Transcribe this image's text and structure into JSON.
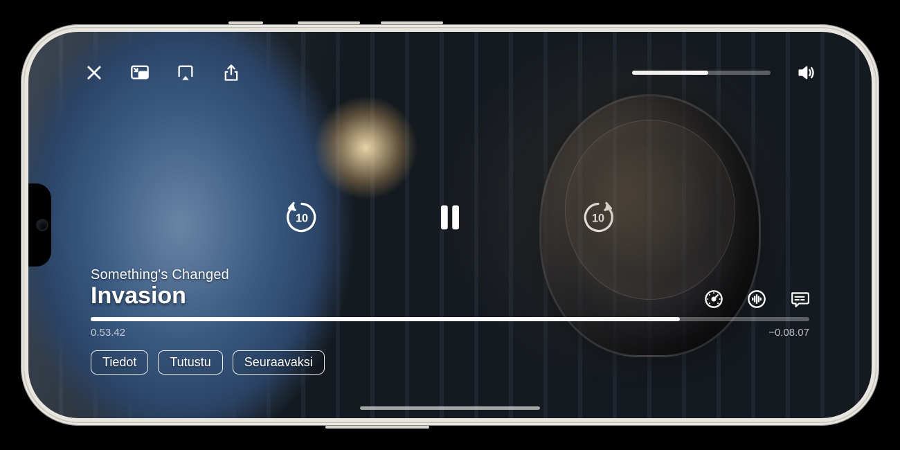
{
  "episode": "Something's Changed",
  "title": "Invasion",
  "time_elapsed": "0.53.42",
  "time_remaining": "−0.08.07",
  "progress_pct": 82,
  "volume_pct": 55,
  "skip_seconds": "10",
  "tabs": {
    "info": "Tiedot",
    "explore": "Tutustu",
    "upnext": "Seuraavaksi"
  }
}
